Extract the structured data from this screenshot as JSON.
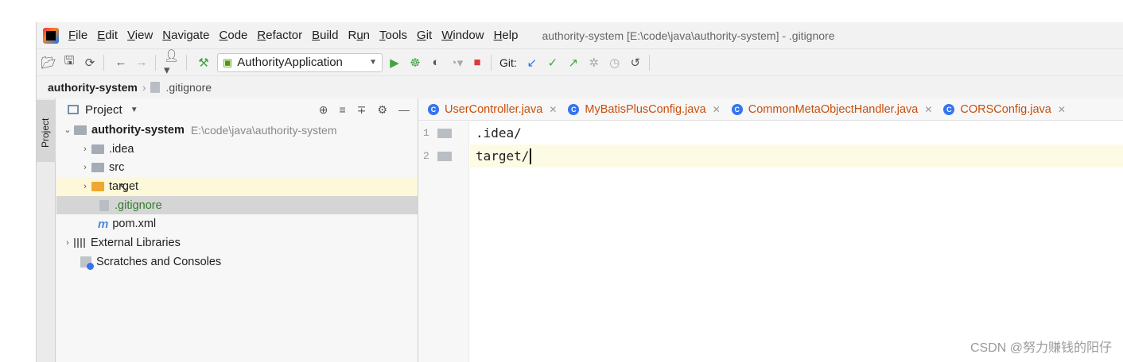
{
  "menu": {
    "items": [
      {
        "label": "File",
        "mnemonic": "F",
        "rest": "ile"
      },
      {
        "label": "Edit",
        "mnemonic": "E",
        "rest": "dit"
      },
      {
        "label": "View",
        "mnemonic": "V",
        "rest": "iew"
      },
      {
        "label": "Navigate",
        "mnemonic": "N",
        "rest": "avigate"
      },
      {
        "label": "Code",
        "mnemonic": "C",
        "rest": "ode"
      },
      {
        "label": "Refactor",
        "mnemonic": "R",
        "rest": "efactor"
      },
      {
        "label": "Build",
        "mnemonic": "B",
        "rest": "uild"
      },
      {
        "label": "Run",
        "pre": "R",
        "mnemonic": "u",
        "rest": "n"
      },
      {
        "label": "Tools",
        "mnemonic": "T",
        "rest": "ools"
      },
      {
        "label": "Git",
        "mnemonic": "G",
        "rest": "it"
      },
      {
        "label": "Window",
        "mnemonic": "W",
        "rest": "indow"
      },
      {
        "label": "Help",
        "mnemonic": "H",
        "rest": "elp"
      }
    ],
    "window_title": "authority-system [E:\\code\\java\\authority-system] - .gitignore"
  },
  "toolbar": {
    "run_config": "AuthorityApplication",
    "git_label": "Git:"
  },
  "breadcrumb": {
    "root": "authority-system",
    "file": ".gitignore"
  },
  "side_strip": {
    "tab_label": "Project"
  },
  "project_panel": {
    "title": "Project",
    "tree": {
      "root_name": "authority-system",
      "root_path": "E:\\code\\java\\authority-system",
      "idea": ".idea",
      "src": "src",
      "target": "target",
      "gitignore": ".gitignore",
      "pom": "pom.xml",
      "external_libraries": "External Libraries",
      "scratches": "Scratches and Consoles"
    }
  },
  "editor": {
    "tabs": [
      {
        "label": "UserController.java"
      },
      {
        "label": "MyBatisPlusConfig.java"
      },
      {
        "label": "CommonMetaObjectHandler.java"
      },
      {
        "label": "CORSConfig.java"
      }
    ],
    "lines": [
      {
        "number": "1",
        "text": ".idea/"
      },
      {
        "number": "2",
        "text": "target/"
      }
    ]
  },
  "watermark": "CSDN @努力赚钱的阳仔",
  "colors": {
    "accent": "#3574f0",
    "run_green": "#3fa63f",
    "stop_red": "#db3b3b",
    "ignored_file_green": "#2f7d2f",
    "excluded_folder_orange": "#f0a732",
    "tab_text_orange": "#c74f0d"
  }
}
